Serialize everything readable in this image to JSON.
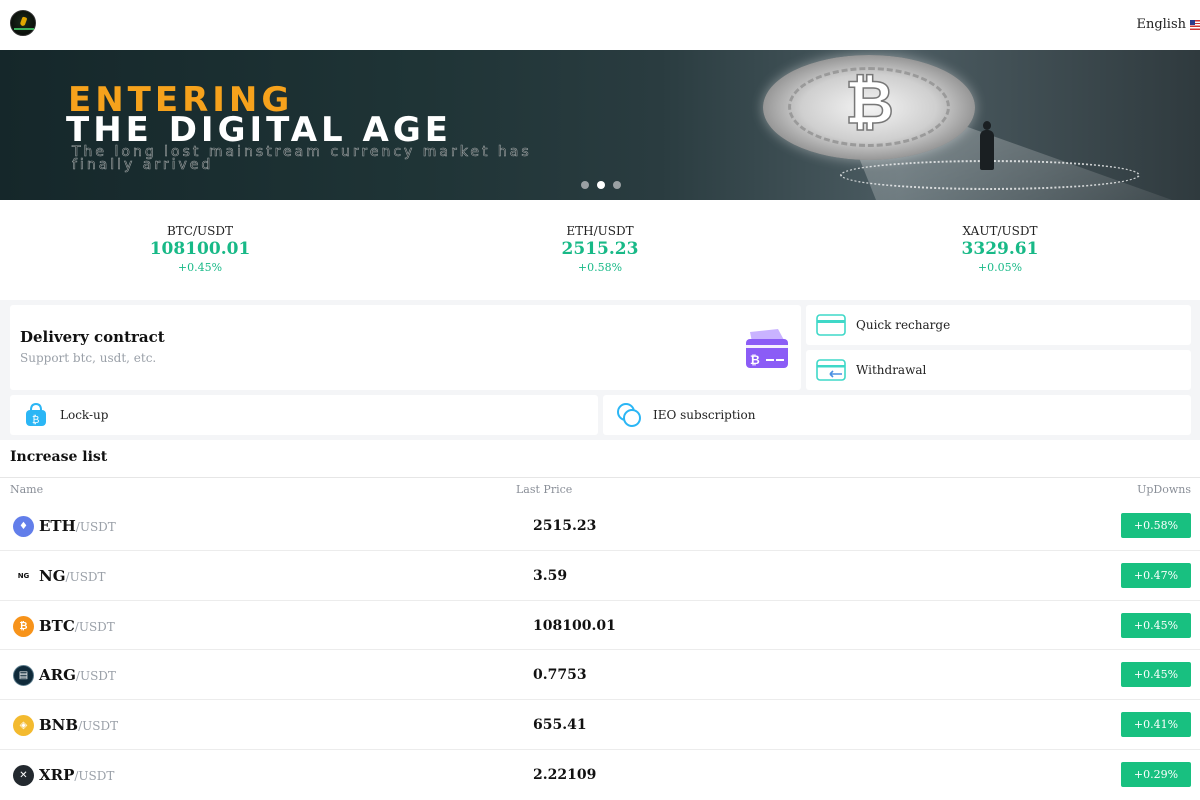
{
  "header": {
    "language_label": "English"
  },
  "banner": {
    "line1": "ENTERING",
    "line2": "THE DIGITAL AGE",
    "line3": "The long lost mainstream currency market has finally arrived",
    "slide_count": 3,
    "active_slide": 2
  },
  "tickers": [
    {
      "pair": "BTC/USDT",
      "price": "108100.01",
      "change": "+0.45%"
    },
    {
      "pair": "ETH/USDT",
      "price": "2515.23",
      "change": "+0.58%"
    },
    {
      "pair": "XAUT/USDT",
      "price": "3329.61",
      "change": "+0.05%"
    }
  ],
  "functions": {
    "delivery_title": "Delivery contract",
    "delivery_subtitle": "Support btc, usdt, etc.",
    "quick_recharge": "Quick recharge",
    "withdrawal": "Withdrawal",
    "lockup": "Lock-up",
    "ieo": "IEO subscription"
  },
  "increase_list": {
    "title": "Increase list",
    "columns": {
      "name": "Name",
      "last_price": "Last Price",
      "updowns": "UpDowns"
    },
    "rows": [
      {
        "symbol": "ETH",
        "quote": "/USDT",
        "price": "2515.23",
        "change": "+0.58%",
        "icon": "eth-icon",
        "color": "#627eea"
      },
      {
        "symbol": "NG",
        "quote": "/USDT",
        "price": "3.59",
        "change": "+0.47%",
        "icon": "ng-icon",
        "color": "#ffffff"
      },
      {
        "symbol": "BTC",
        "quote": "/USDT",
        "price": "108100.01",
        "change": "+0.45%",
        "icon": "btc-icon",
        "color": "#f7931a"
      },
      {
        "symbol": "ARG",
        "quote": "/USDT",
        "price": "0.7753",
        "change": "+0.45%",
        "icon": "arg-icon",
        "color": "#0f2a3a"
      },
      {
        "symbol": "BNB",
        "quote": "/USDT",
        "price": "655.41",
        "change": "+0.41%",
        "icon": "bnb-icon",
        "color": "#f3ba2f"
      },
      {
        "symbol": "XRP",
        "quote": "/USDT",
        "price": "2.22109",
        "change": "+0.29%",
        "icon": "xrp-icon",
        "color": "#23292f"
      }
    ]
  },
  "colors": {
    "up_green": "#18c080",
    "price_green": "#18b987",
    "banner_orange": "#f6a21c",
    "page_bg_gray": "#f4f5f7"
  }
}
